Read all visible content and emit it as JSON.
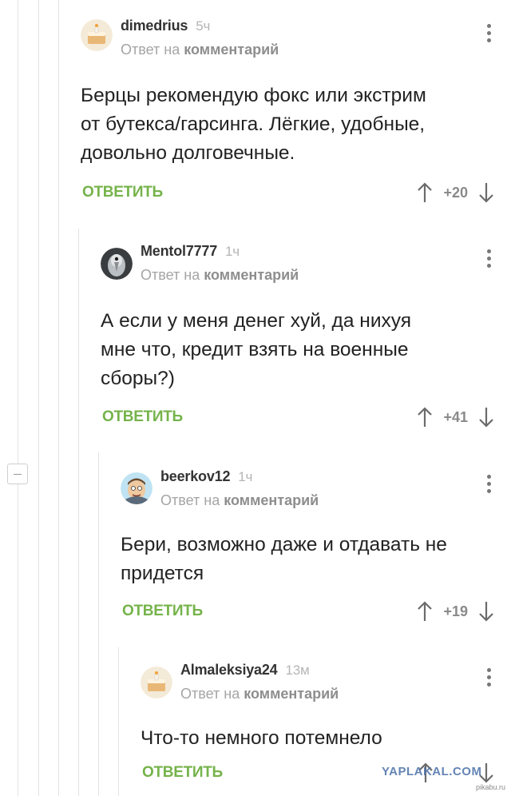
{
  "comments": [
    {
      "user": "dimedrius",
      "time": "5ч",
      "reply_prefix": "Ответ на",
      "reply_target": "комментарий",
      "lines": [
        "Берцы рекомендую фокс или экстрим",
        "от бутекса/гарсинга. Лёгкие, удобные,",
        "довольно долговечные."
      ],
      "reply_label": "ОТВЕТИТЬ",
      "score": "+20",
      "avatar": "cake-avatar-icon"
    },
    {
      "user": "Mentol7777",
      "time": "1ч",
      "reply_prefix": "Ответ на",
      "reply_target": "комментарий",
      "lines": [
        "А если у меня денег хуй, да нихуя",
        "мне что, кредит взять на военные",
        "сборы?)"
      ],
      "reply_label": "ОТВЕТИТЬ",
      "score": "+41",
      "avatar": "bird-photo-avatar-icon"
    },
    {
      "user": "beerkov12",
      "time": "1ч",
      "reply_prefix": "Ответ на",
      "reply_target": "комментарий",
      "lines": [
        "Бери, возможно даже и отдавать не",
        "придется"
      ],
      "reply_label": "ОТВЕТИТЬ",
      "score": "+19",
      "avatar": "cartoon-face-avatar-icon"
    },
    {
      "user": "Almaleksiya24",
      "time": "13м",
      "reply_prefix": "Ответ на",
      "reply_target": "комментарий",
      "lines": [
        "Что-то немного потемнело"
      ],
      "reply_label": "ОТВЕТИТЬ",
      "avatar": "cake-avatar-icon"
    }
  ],
  "watermark": "YAPLAKAL.COM",
  "watermark_small": "pikabu.ru",
  "colors": {
    "accent": "#75b34a",
    "text": "#222222",
    "muted": "#a5a5a5",
    "rail": "#e3e3e3"
  }
}
